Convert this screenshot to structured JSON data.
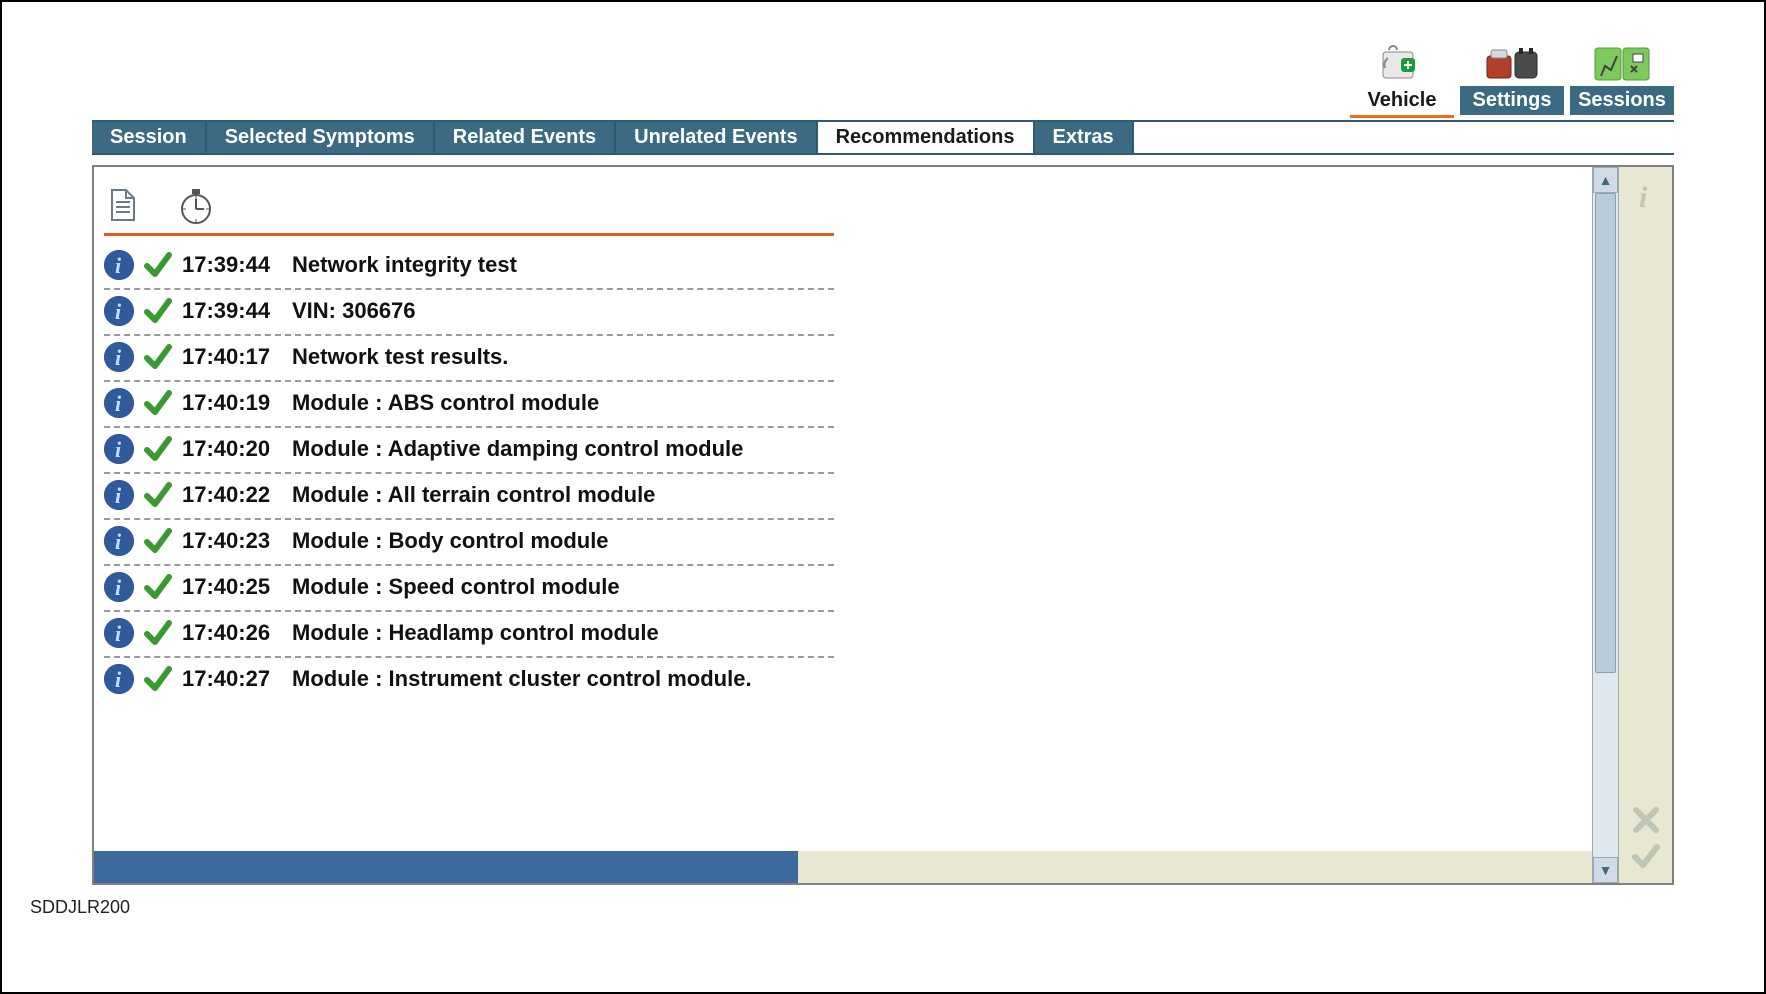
{
  "topnav": [
    {
      "id": "vehicle",
      "label": "Vehicle",
      "active": true
    },
    {
      "id": "settings",
      "label": "Settings",
      "active": false
    },
    {
      "id": "sessions",
      "label": "Sessions",
      "active": false
    }
  ],
  "tabs": [
    {
      "id": "session",
      "label": "Session"
    },
    {
      "id": "selected-symptoms",
      "label": "Selected Symptoms"
    },
    {
      "id": "related-events",
      "label": "Related Events"
    },
    {
      "id": "unrelated-events",
      "label": "Unrelated Events"
    },
    {
      "id": "recommendations",
      "label": "Recommendations",
      "active": true
    },
    {
      "id": "extras",
      "label": "Extras"
    }
  ],
  "log": {
    "rows": [
      {
        "time": "17:39:44",
        "desc": "Network integrity test"
      },
      {
        "time": "17:39:44",
        "desc": "VIN: 306676"
      },
      {
        "time": "17:40:17",
        "desc": "Network test results."
      },
      {
        "time": "17:40:19",
        "desc": "Module : ABS control module"
      },
      {
        "time": "17:40:20",
        "desc": "Module : Adaptive damping control module"
      },
      {
        "time": "17:40:22",
        "desc": "Module : All terrain control module"
      },
      {
        "time": "17:40:23",
        "desc": "Module : Body control module"
      },
      {
        "time": "17:40:25",
        "desc": "Module : Speed control module"
      },
      {
        "time": "17:40:26",
        "desc": "Module : Headlamp control module"
      },
      {
        "time": "17:40:27",
        "desc": "Module : Instrument cluster control module."
      }
    ]
  },
  "caption": "SDDJLR200"
}
